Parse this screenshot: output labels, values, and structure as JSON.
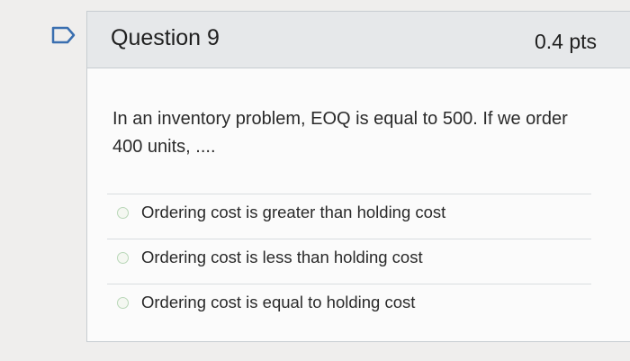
{
  "question": {
    "title": "Question 9",
    "points": "0.4 pts",
    "text": "In an inventory problem, EOQ is equal to 500. If we order 400 units, ....",
    "flag_icon": "flag-icon"
  },
  "answers": [
    {
      "label": "Ordering cost is greater than holding cost"
    },
    {
      "label": "Ordering cost is less than holding cost"
    },
    {
      "label": "Ordering cost is equal to holding cost"
    }
  ],
  "colors": {
    "header_bg": "#e6e8ea",
    "card_bg": "#fbfbfb",
    "border": "#c7cdd1",
    "flag": "#3a6fb0"
  }
}
